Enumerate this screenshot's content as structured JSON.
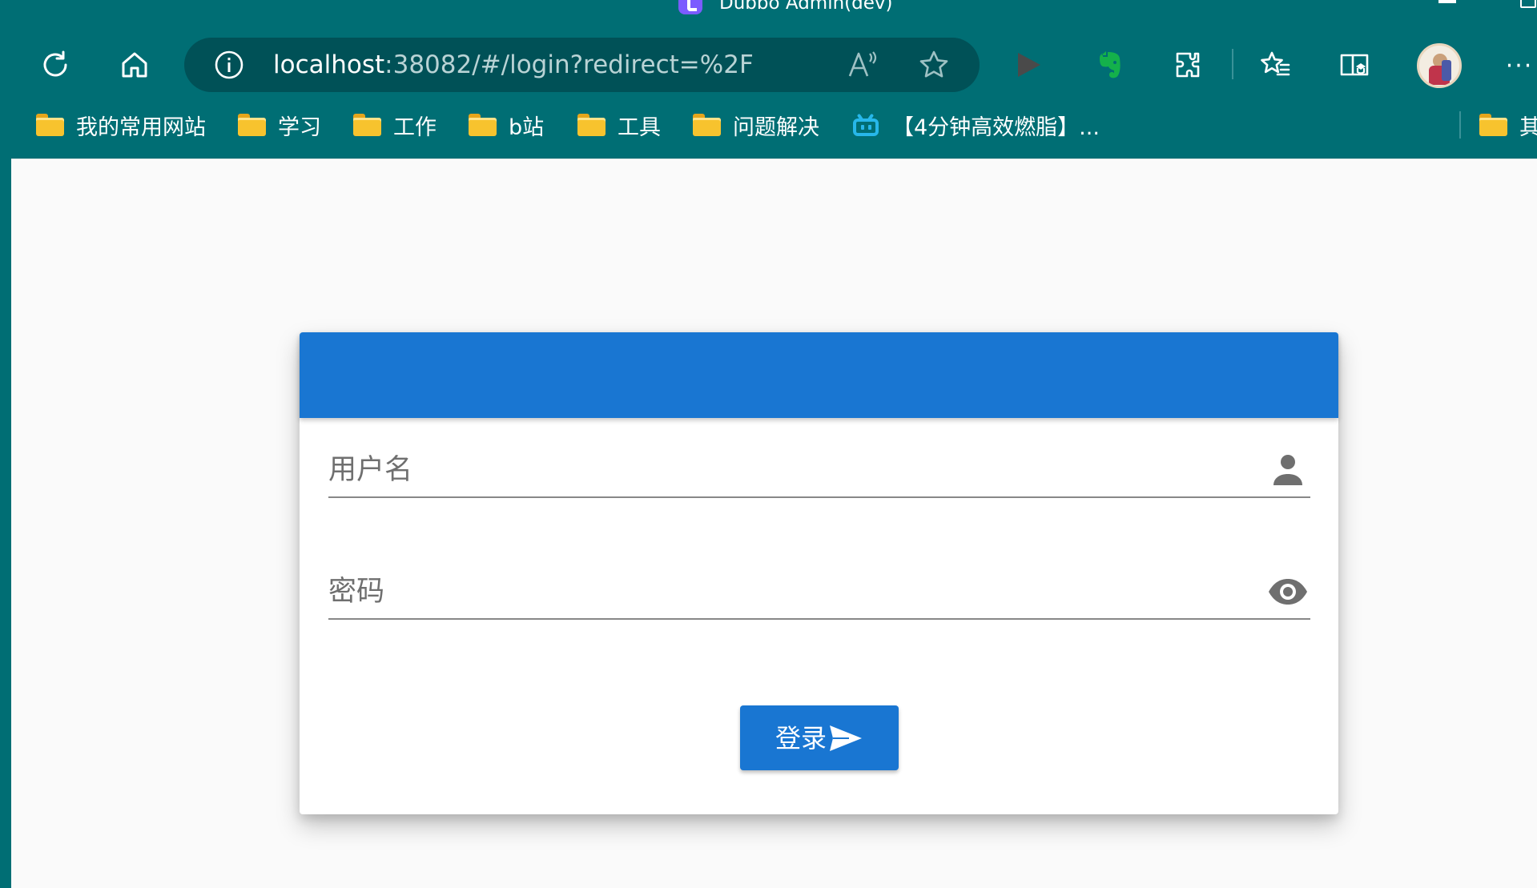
{
  "window": {
    "title": "Dubbo Admin(dev)"
  },
  "toolbar": {
    "icons": [
      "refresh-icon",
      "home-icon",
      "info-icon",
      "read-aloud-icon",
      "star-icon",
      "play-icon",
      "evernote-icon",
      "extensions-icon",
      "favorites-icon",
      "collections-icon",
      "avatar",
      "more-icon"
    ],
    "more_label": "···"
  },
  "address": {
    "host": "localhost",
    "rest": ":38082/#/login?redirect=%2F",
    "read_aloud_label": "A⁾"
  },
  "bookmarks": {
    "items": [
      {
        "label": "我的常用网站",
        "icon": "folder-icon"
      },
      {
        "label": "学习",
        "icon": "folder-icon"
      },
      {
        "label": "工作",
        "icon": "folder-icon"
      },
      {
        "label": "b站",
        "icon": "folder-icon"
      },
      {
        "label": "工具",
        "icon": "folder-icon"
      },
      {
        "label": "问题解决",
        "icon": "folder-icon"
      },
      {
        "label": "【4分钟高效燃脂】...",
        "icon": "bilibili-icon"
      },
      {
        "label": "其",
        "icon": "folder-icon"
      }
    ]
  },
  "login": {
    "username_placeholder": "用户名",
    "password_placeholder": "密码",
    "submit_label": "登录",
    "colors": {
      "header": "#1976d2",
      "button": "#1976d2",
      "browser_chrome": "#006e74"
    }
  }
}
